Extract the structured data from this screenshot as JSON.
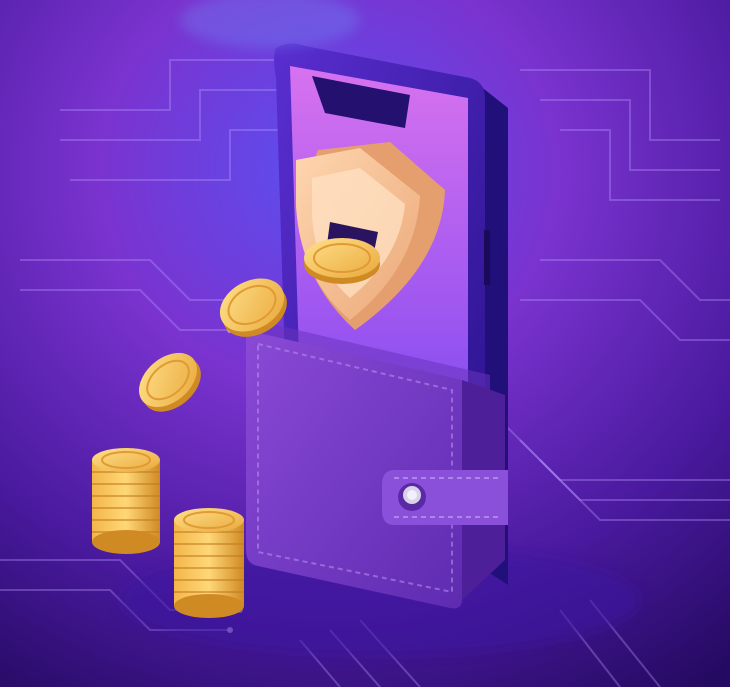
{
  "scene": {
    "description_free": true,
    "colors": {
      "background_top": "#2f5fd8",
      "background_mid": "#6a2fc8",
      "background_bottom": "#2a0a6a",
      "circuit_line": "#a98cff",
      "phone_body": "#3b1a9e",
      "phone_screen_top": "#c76bf0",
      "phone_screen_bottom": "#6d46f0",
      "shield_face": "#f7c9a2",
      "shield_edge": "#e6a77c",
      "wallet": "#7a3fc9",
      "wallet_dark": "#5a2aa6",
      "coin_gold": "#f6c453",
      "coin_gold_dark": "#d6952a"
    },
    "icons": [
      "smartphone-icon",
      "shield-icon",
      "wallet-icon",
      "coin-icon",
      "coin-stack-icon"
    ]
  }
}
